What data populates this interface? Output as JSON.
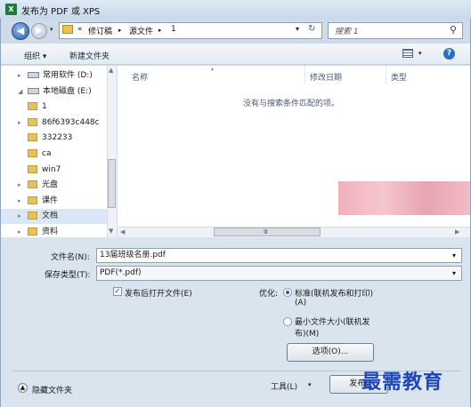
{
  "title": "发布为 PDF 或 XPS",
  "titlebar_icon": "X",
  "address": {
    "prefix": "«",
    "crumbs": [
      "修订稿",
      "源文件",
      "1"
    ],
    "separator": "▸",
    "search_placeholder": "搜索 1"
  },
  "toolbar": {
    "organize": "组织 ▾",
    "new_folder": "新建文件夹"
  },
  "tree": [
    {
      "label": "常用软件 (D:)",
      "type": "drive",
      "expander": "▸"
    },
    {
      "label": "本地磁盘 (E:)",
      "type": "drive",
      "expander": "◢"
    },
    {
      "label": "1",
      "type": "folder",
      "expander": ""
    },
    {
      "label": "86f6393c448c",
      "type": "folder",
      "expander": "▸"
    },
    {
      "label": "332233",
      "type": "folder",
      "expander": ""
    },
    {
      "label": "ca",
      "type": "folder",
      "expander": ""
    },
    {
      "label": "win7",
      "type": "folder",
      "expander": ""
    },
    {
      "label": "光盘",
      "type": "folder",
      "expander": "▸"
    },
    {
      "label": "课件",
      "type": "folder",
      "expander": "▸"
    },
    {
      "label": "文档",
      "type": "folder",
      "expander": "▸",
      "selected": true
    },
    {
      "label": "资料",
      "type": "folder",
      "expander": "▸"
    }
  ],
  "columns": [
    "名称",
    "修改日期",
    "类型"
  ],
  "empty_message": "没有与搜索条件匹配的项。",
  "form": {
    "filename_label": "文件名(N):",
    "filename_value": "13届班级名册.pdf",
    "filetype_label": "保存类型(T):",
    "filetype_value": "PDF(*.pdf)",
    "open_after_label": "发布后打开文件(E)",
    "open_after_checked": true,
    "optimize_label": "优化:",
    "opt_standard_line1": "标准(联机发布和打印)",
    "opt_standard_line2": "(A)",
    "opt_min_line1": "最小文件大小(联机发",
    "opt_min_line2": "布)(M)",
    "options_button": "选项(O)...",
    "hide_folders": "隐藏文件夹",
    "tools_button": "工具(L)",
    "publish_button": "发布("
  },
  "watermark": "最需教育",
  "colors": {
    "accent": "#2a5ea8",
    "watermark": "#1d45b3",
    "folder": "#e8c15a"
  }
}
